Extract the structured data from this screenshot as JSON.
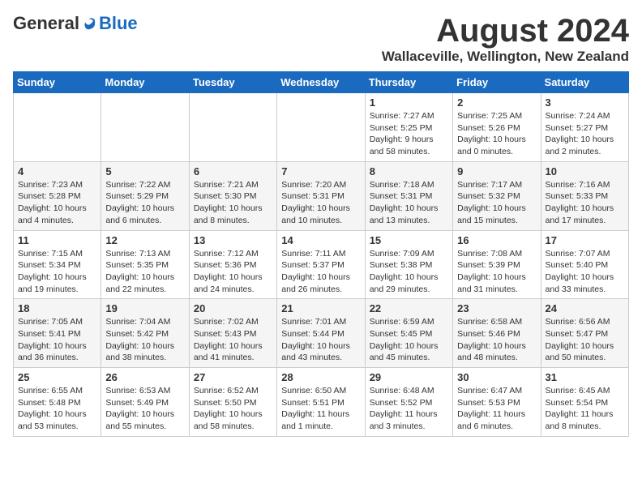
{
  "logo": {
    "general": "General",
    "blue": "Blue"
  },
  "header": {
    "title": "August 2024",
    "subtitle": "Wallaceville, Wellington, New Zealand"
  },
  "days_of_week": [
    "Sunday",
    "Monday",
    "Tuesday",
    "Wednesday",
    "Thursday",
    "Friday",
    "Saturday"
  ],
  "weeks": [
    [
      {
        "day": "",
        "detail": ""
      },
      {
        "day": "",
        "detail": ""
      },
      {
        "day": "",
        "detail": ""
      },
      {
        "day": "",
        "detail": ""
      },
      {
        "day": "1",
        "detail": "Sunrise: 7:27 AM\nSunset: 5:25 PM\nDaylight: 9 hours\nand 58 minutes."
      },
      {
        "day": "2",
        "detail": "Sunrise: 7:25 AM\nSunset: 5:26 PM\nDaylight: 10 hours\nand 0 minutes."
      },
      {
        "day": "3",
        "detail": "Sunrise: 7:24 AM\nSunset: 5:27 PM\nDaylight: 10 hours\nand 2 minutes."
      }
    ],
    [
      {
        "day": "4",
        "detail": "Sunrise: 7:23 AM\nSunset: 5:28 PM\nDaylight: 10 hours\nand 4 minutes."
      },
      {
        "day": "5",
        "detail": "Sunrise: 7:22 AM\nSunset: 5:29 PM\nDaylight: 10 hours\nand 6 minutes."
      },
      {
        "day": "6",
        "detail": "Sunrise: 7:21 AM\nSunset: 5:30 PM\nDaylight: 10 hours\nand 8 minutes."
      },
      {
        "day": "7",
        "detail": "Sunrise: 7:20 AM\nSunset: 5:31 PM\nDaylight: 10 hours\nand 10 minutes."
      },
      {
        "day": "8",
        "detail": "Sunrise: 7:18 AM\nSunset: 5:31 PM\nDaylight: 10 hours\nand 13 minutes."
      },
      {
        "day": "9",
        "detail": "Sunrise: 7:17 AM\nSunset: 5:32 PM\nDaylight: 10 hours\nand 15 minutes."
      },
      {
        "day": "10",
        "detail": "Sunrise: 7:16 AM\nSunset: 5:33 PM\nDaylight: 10 hours\nand 17 minutes."
      }
    ],
    [
      {
        "day": "11",
        "detail": "Sunrise: 7:15 AM\nSunset: 5:34 PM\nDaylight: 10 hours\nand 19 minutes."
      },
      {
        "day": "12",
        "detail": "Sunrise: 7:13 AM\nSunset: 5:35 PM\nDaylight: 10 hours\nand 22 minutes."
      },
      {
        "day": "13",
        "detail": "Sunrise: 7:12 AM\nSunset: 5:36 PM\nDaylight: 10 hours\nand 24 minutes."
      },
      {
        "day": "14",
        "detail": "Sunrise: 7:11 AM\nSunset: 5:37 PM\nDaylight: 10 hours\nand 26 minutes."
      },
      {
        "day": "15",
        "detail": "Sunrise: 7:09 AM\nSunset: 5:38 PM\nDaylight: 10 hours\nand 29 minutes."
      },
      {
        "day": "16",
        "detail": "Sunrise: 7:08 AM\nSunset: 5:39 PM\nDaylight: 10 hours\nand 31 minutes."
      },
      {
        "day": "17",
        "detail": "Sunrise: 7:07 AM\nSunset: 5:40 PM\nDaylight: 10 hours\nand 33 minutes."
      }
    ],
    [
      {
        "day": "18",
        "detail": "Sunrise: 7:05 AM\nSunset: 5:41 PM\nDaylight: 10 hours\nand 36 minutes."
      },
      {
        "day": "19",
        "detail": "Sunrise: 7:04 AM\nSunset: 5:42 PM\nDaylight: 10 hours\nand 38 minutes."
      },
      {
        "day": "20",
        "detail": "Sunrise: 7:02 AM\nSunset: 5:43 PM\nDaylight: 10 hours\nand 41 minutes."
      },
      {
        "day": "21",
        "detail": "Sunrise: 7:01 AM\nSunset: 5:44 PM\nDaylight: 10 hours\nand 43 minutes."
      },
      {
        "day": "22",
        "detail": "Sunrise: 6:59 AM\nSunset: 5:45 PM\nDaylight: 10 hours\nand 45 minutes."
      },
      {
        "day": "23",
        "detail": "Sunrise: 6:58 AM\nSunset: 5:46 PM\nDaylight: 10 hours\nand 48 minutes."
      },
      {
        "day": "24",
        "detail": "Sunrise: 6:56 AM\nSunset: 5:47 PM\nDaylight: 10 hours\nand 50 minutes."
      }
    ],
    [
      {
        "day": "25",
        "detail": "Sunrise: 6:55 AM\nSunset: 5:48 PM\nDaylight: 10 hours\nand 53 minutes."
      },
      {
        "day": "26",
        "detail": "Sunrise: 6:53 AM\nSunset: 5:49 PM\nDaylight: 10 hours\nand 55 minutes."
      },
      {
        "day": "27",
        "detail": "Sunrise: 6:52 AM\nSunset: 5:50 PM\nDaylight: 10 hours\nand 58 minutes."
      },
      {
        "day": "28",
        "detail": "Sunrise: 6:50 AM\nSunset: 5:51 PM\nDaylight: 11 hours\nand 1 minute."
      },
      {
        "day": "29",
        "detail": "Sunrise: 6:48 AM\nSunset: 5:52 PM\nDaylight: 11 hours\nand 3 minutes."
      },
      {
        "day": "30",
        "detail": "Sunrise: 6:47 AM\nSunset: 5:53 PM\nDaylight: 11 hours\nand 6 minutes."
      },
      {
        "day": "31",
        "detail": "Sunrise: 6:45 AM\nSunset: 5:54 PM\nDaylight: 11 hours\nand 8 minutes."
      }
    ]
  ]
}
